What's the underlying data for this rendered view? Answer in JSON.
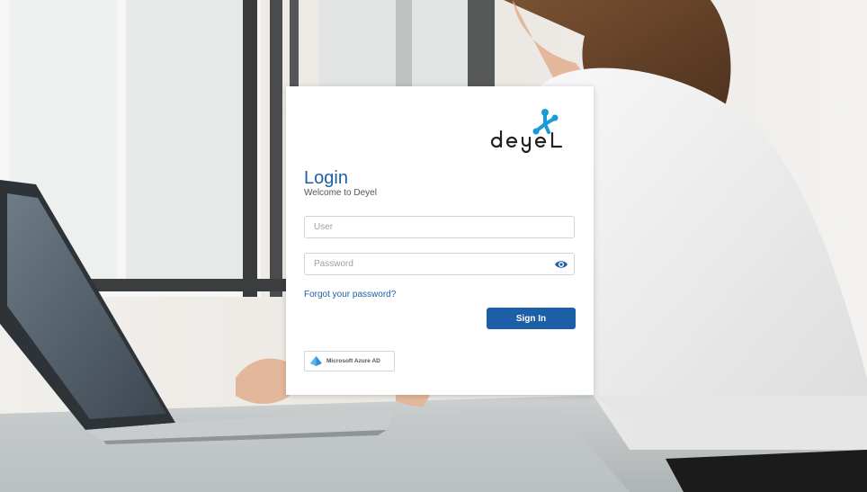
{
  "brand": {
    "name": "deyel",
    "accent_color": "#1d5fa7"
  },
  "login": {
    "title": "Login",
    "subtitle": "Welcome to Deyel"
  },
  "form": {
    "user_placeholder": "User",
    "user_value": "",
    "password_placeholder": "Password",
    "password_value": "",
    "show_password_icon": "eye-icon",
    "forgot_label": "Forgot your password?",
    "signin_label": "Sign In"
  },
  "sso": {
    "azure_label": "Microsoft Azure AD",
    "azure_icon": "azure-icon"
  }
}
